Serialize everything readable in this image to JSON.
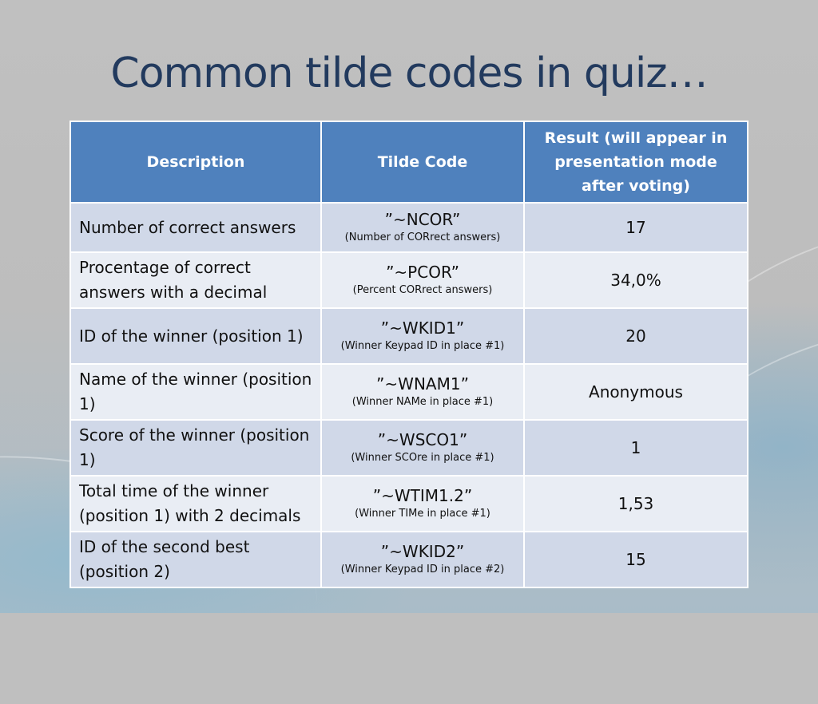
{
  "slide": {
    "title": "Common tilde codes in quiz…"
  },
  "table": {
    "headers": {
      "description": "Description",
      "tilde_code": "Tilde Code",
      "result": "Result (will appear in presentation mode after voting)"
    },
    "rows": [
      {
        "description": "Number of correct answers",
        "code": "”~NCOR”",
        "code_note": "(Number of CORrect answers)",
        "result": "17"
      },
      {
        "description": "Procentage of correct answers with a decimal",
        "code": "”~PCOR”",
        "code_note": "(Percent CORrect answers)",
        "result": "34,0%"
      },
      {
        "description": "ID of the winner (position 1)",
        "code": "”~WKID1”",
        "code_note": "(Winner Keypad ID in place #1)",
        "result": "20"
      },
      {
        "description": "Name of the winner (position 1)",
        "code": "”~WNAM1”",
        "code_note": "(Winner NAMe in place #1)",
        "result": "Anonymous"
      },
      {
        "description": "Score of the winner (position 1)",
        "code": "”~WSCO1”",
        "code_note": "(Winner SCOre in place #1)",
        "result": "1"
      },
      {
        "description": "Total time of the winner (position 1) with 2 decimals",
        "code": "”~WTIM1.2”",
        "code_note": "(Winner TIMe in place #1)",
        "result": "1,53"
      },
      {
        "description": "ID of the second best (position 2)",
        "code": "”~WKID2”",
        "code_note": "(Winner Keypad ID in place #2)",
        "result": "15"
      }
    ]
  },
  "colors": {
    "header_bg": "#4f81bd",
    "row_odd_bg": "#d0d8e8",
    "row_even_bg": "#e9edf4",
    "title_color": "#223a5e"
  }
}
